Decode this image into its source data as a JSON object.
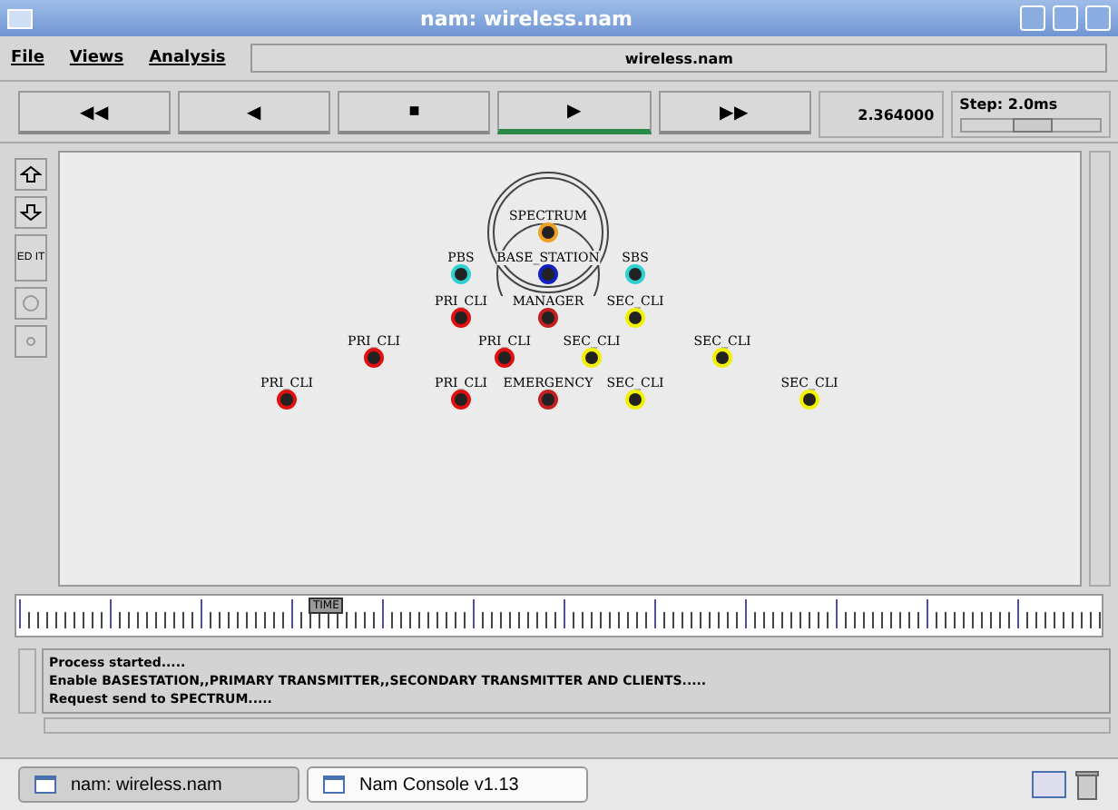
{
  "window": {
    "title": "nam: wireless.nam"
  },
  "menu": [
    "File",
    "Views",
    "Analysis"
  ],
  "file_label": "wireless.nam",
  "transport": [
    {
      "symbol": "◀◀",
      "selected": false
    },
    {
      "symbol": "◀",
      "selected": false
    },
    {
      "symbol": "■",
      "selected": false
    },
    {
      "symbol": "▶",
      "selected": true
    },
    {
      "symbol": "▶▶",
      "selected": false
    }
  ],
  "time": "2.364000",
  "step": {
    "label": "Step: 2.0ms",
    "level": 0.5
  },
  "tools": [
    {
      "kind": "up"
    },
    {
      "kind": "down"
    },
    {
      "kind": "text",
      "label": "ED IT"
    },
    {
      "kind": "circle"
    },
    {
      "kind": "dot"
    }
  ],
  "nodes": [
    {
      "label": "SPECTRUM",
      "color": "#f0a020"
    },
    {
      "label": "PBS",
      "color": "#30d0d0"
    },
    {
      "label": "BASE_STATION",
      "color": "#1020c0"
    },
    {
      "label": "SBS",
      "color": "#30d0d0"
    },
    {
      "label": "PRI_CLI",
      "color": "#e01010"
    },
    {
      "label": "MANAGER",
      "color": "#c02020"
    },
    {
      "label": "SEC_CLI",
      "color": "#f0f000"
    },
    {
      "label": "PRI_CLI",
      "color": "#e01010"
    },
    {
      "label": "PRI_CLI",
      "color": "#e01010"
    },
    {
      "label": "SEC_CLI",
      "color": "#f0f000"
    },
    {
      "label": "SEC_CLI",
      "color": "#f0f000"
    },
    {
      "label": "PRI_CLI",
      "color": "#e01010"
    },
    {
      "label": "PRI_CLI",
      "color": "#e01010"
    },
    {
      "label": "EMERGENCY",
      "color": "#c02020"
    },
    {
      "label": "SEC_CLI",
      "color": "#f0f000"
    },
    {
      "label": "SEC_CLI",
      "color": "#f0f000"
    }
  ],
  "timeline": {
    "marker": "TIME",
    "level": 0.27
  },
  "console": [
    "Process started.....",
    "Enable BASESTATION,,PRIMARY TRANSMITTER,,SECONDARY TRANSMITTER AND CLIENTS.....",
    "Request send to SPECTRUM....."
  ],
  "taskbar": [
    {
      "label": "nam: wireless.nam",
      "selected": true
    },
    {
      "label": "Nam Console v1.13",
      "selected": false
    }
  ]
}
